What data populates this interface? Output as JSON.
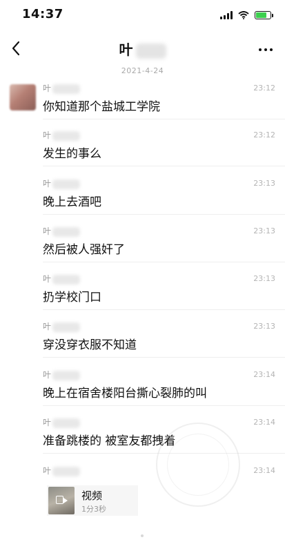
{
  "status_bar": {
    "time": "14:37"
  },
  "nav": {
    "title": "叶"
  },
  "date_separator": "2021-4-24",
  "messages": [
    {
      "sender": "叶",
      "time": "23:12",
      "text": "你知道那个盐城工学院"
    },
    {
      "sender": "叶",
      "time": "23:12",
      "text": "发生的事么"
    },
    {
      "sender": "叶",
      "time": "23:13",
      "text": "晚上去酒吧"
    },
    {
      "sender": "叶",
      "time": "23:13",
      "text": "然后被人强奸了"
    },
    {
      "sender": "叶",
      "time": "23:13",
      "text": "扔学校门口"
    },
    {
      "sender": "叶",
      "time": "23:13",
      "text": "穿没穿衣服不知道"
    },
    {
      "sender": "叶",
      "time": "23:14",
      "text": "晚上在宿舍楼阳台撕心裂肺的叫"
    },
    {
      "sender": "叶",
      "time": "23:14",
      "text": "准备跳楼的 被室友都拽着"
    },
    {
      "sender": "叶",
      "time": "23:14",
      "text": ""
    }
  ],
  "video": {
    "title": "视频",
    "duration": "1分3秒"
  }
}
